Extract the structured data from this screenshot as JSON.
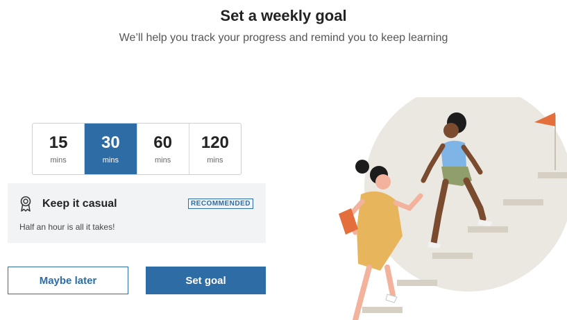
{
  "header": {
    "title": "Set a weekly goal",
    "subtitle": "We’ll help you track your progress and remind you to keep learning"
  },
  "goal_options": [
    {
      "value": "15",
      "unit": "mins",
      "selected": false
    },
    {
      "value": "30",
      "unit": "mins",
      "selected": true
    },
    {
      "value": "60",
      "unit": "mins",
      "selected": false
    },
    {
      "value": "120",
      "unit": "mins",
      "selected": false
    }
  ],
  "info": {
    "icon": "award-ribbon-icon",
    "heading": "Keep it casual",
    "badge": "RECOMMENDED",
    "text": "Half an hour is all it takes!"
  },
  "buttons": {
    "later_label": "Maybe later",
    "set_label": "Set goal"
  },
  "colors": {
    "accent": "#2e6ca5",
    "info_bg": "#f2f3f5"
  },
  "illustration": {
    "icon": "climbing-stairs-illustration"
  }
}
